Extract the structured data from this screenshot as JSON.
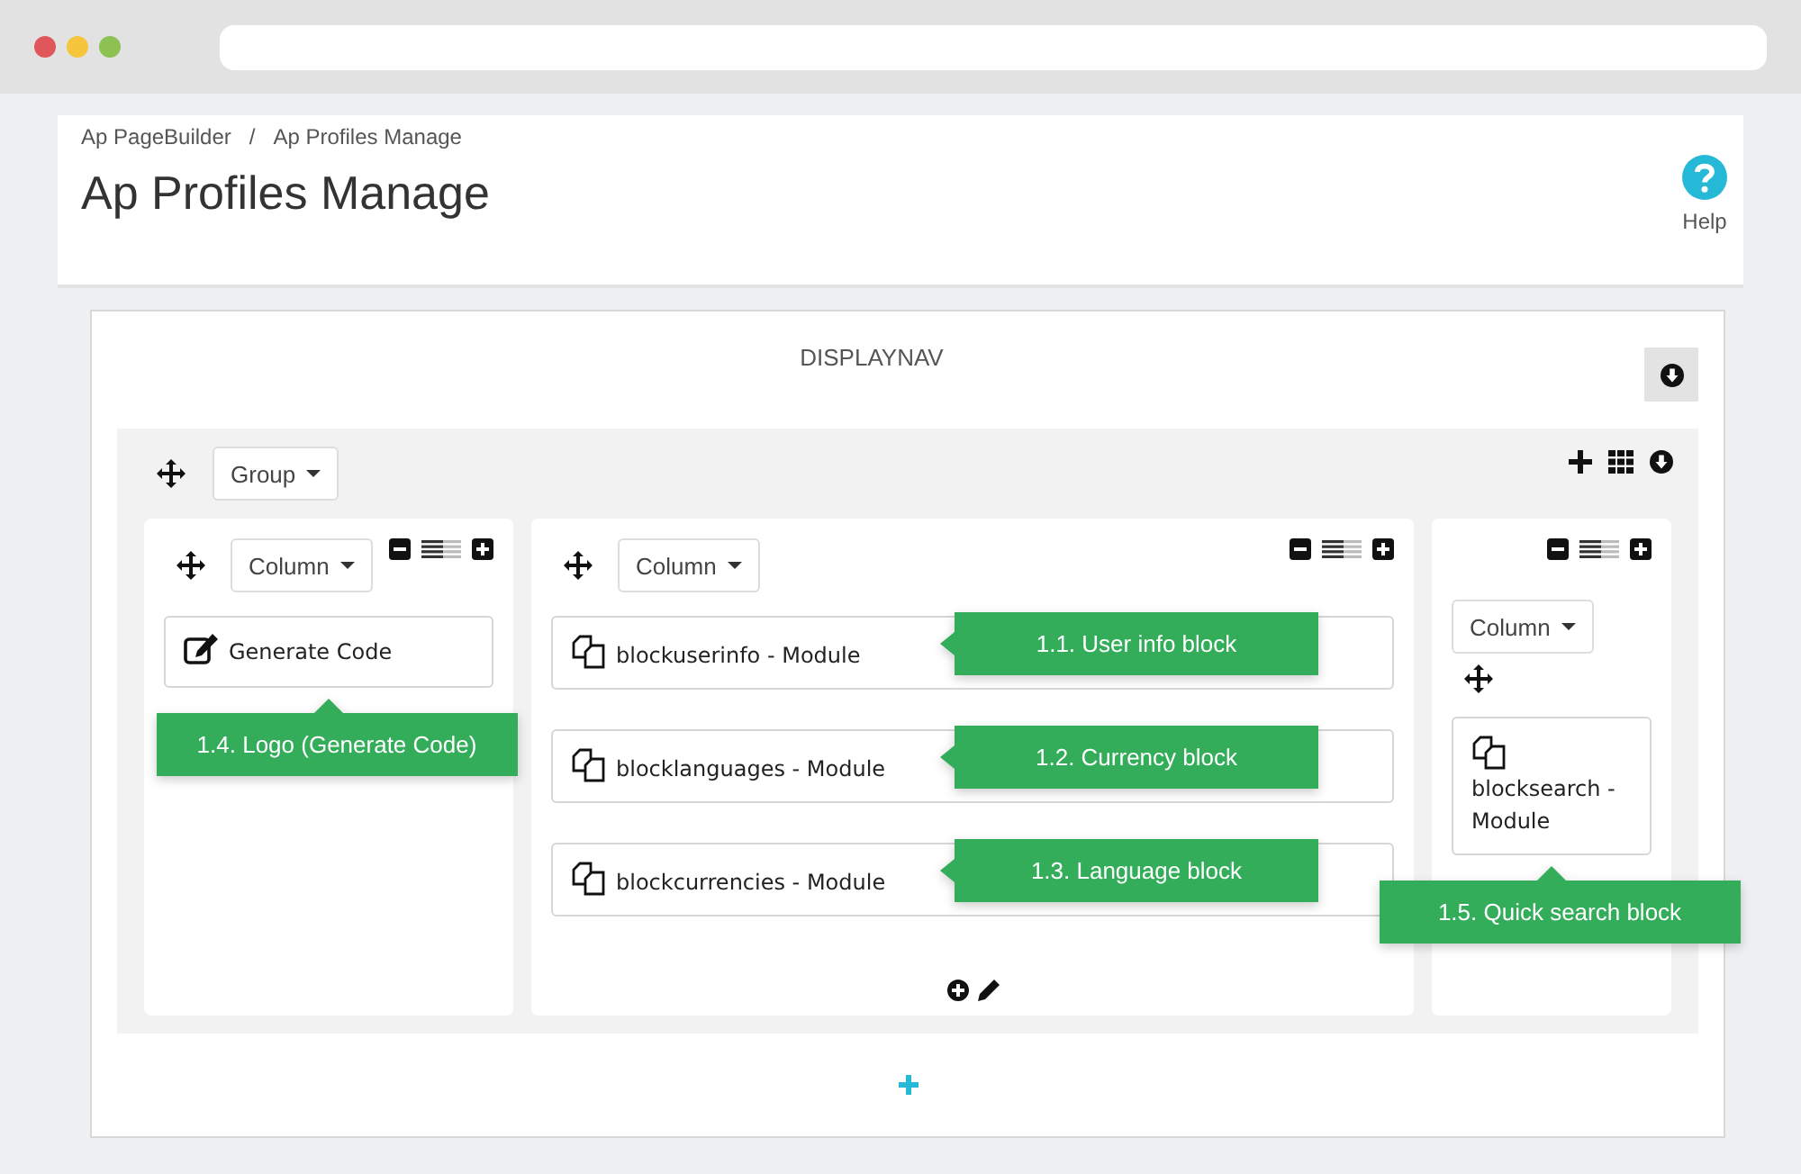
{
  "breadcrumb": [
    {
      "label": "Ap PageBuilder"
    },
    {
      "label": "Ap Profiles Manage"
    }
  ],
  "breadcrumb_separator": "/",
  "title": "Ap Profiles Manage",
  "help": {
    "label": "Help"
  },
  "hook": {
    "name": "DISPLAYNAV"
  },
  "group": {
    "label": "Group"
  },
  "columns": [
    {
      "label": "Column",
      "footer_tools": false,
      "modules": [
        {
          "kind": "code",
          "label": "Generate Code",
          "callout": {
            "text": "1.4. Logo (Generate Code)",
            "kind": "up"
          }
        }
      ]
    },
    {
      "label": "Column",
      "footer_tools": true,
      "modules": [
        {
          "kind": "module",
          "label": "blockuserinfo - Module",
          "callout": {
            "text": "1.1. User info block",
            "kind": "left"
          }
        },
        {
          "kind": "module",
          "label": "blocklanguages - Module",
          "callout": {
            "text": "1.2. Currency block",
            "kind": "left"
          }
        },
        {
          "kind": "module",
          "label": "blockcurrencies - Module",
          "callout": {
            "text": "1.3. Language block",
            "kind": "left"
          }
        }
      ]
    },
    {
      "label": "Column",
      "footer_tools": false,
      "modules": [
        {
          "kind": "module",
          "label": "blocksearch - Module",
          "callout": {
            "text": "1.5. Quick search block",
            "kind": "up"
          }
        }
      ]
    }
  ]
}
